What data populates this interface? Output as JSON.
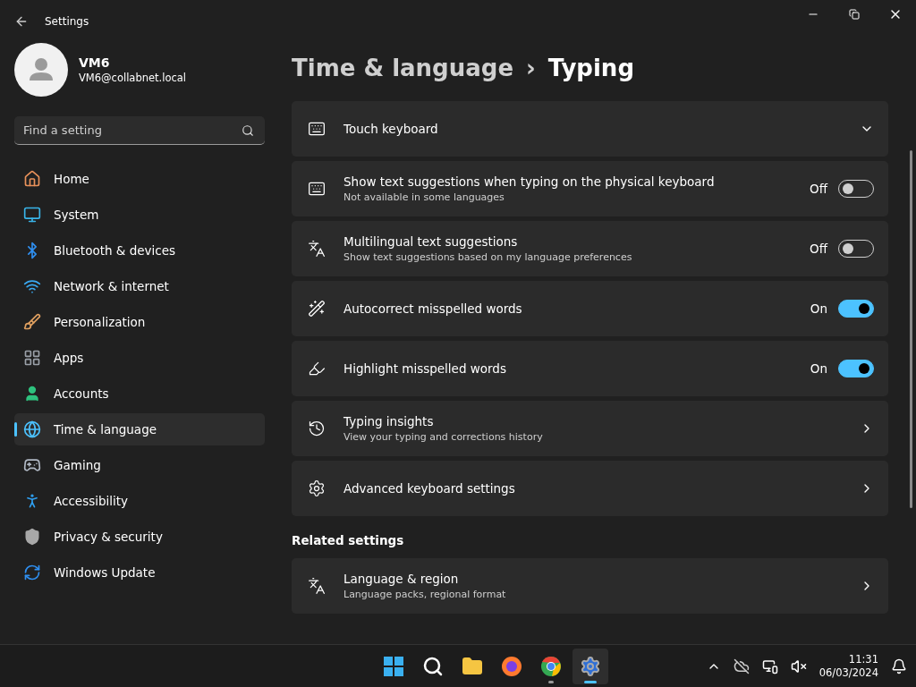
{
  "window": {
    "title": "Settings"
  },
  "user": {
    "name": "VM6",
    "email": "VM6@collabnet.local"
  },
  "search": {
    "placeholder": "Find a setting"
  },
  "sidebar": {
    "items": [
      {
        "label": "Home",
        "selected": false
      },
      {
        "label": "System",
        "selected": false
      },
      {
        "label": "Bluetooth & devices",
        "selected": false
      },
      {
        "label": "Network & internet",
        "selected": false
      },
      {
        "label": "Personalization",
        "selected": false
      },
      {
        "label": "Apps",
        "selected": false
      },
      {
        "label": "Accounts",
        "selected": false
      },
      {
        "label": "Time & language",
        "selected": true
      },
      {
        "label": "Gaming",
        "selected": false
      },
      {
        "label": "Accessibility",
        "selected": false
      },
      {
        "label": "Privacy & security",
        "selected": false
      },
      {
        "label": "Windows Update",
        "selected": false
      }
    ]
  },
  "breadcrumb": {
    "parent": "Time & language",
    "separator": "›",
    "current": "Typing"
  },
  "settings": [
    {
      "kind": "expander",
      "title": "Touch keyboard"
    },
    {
      "kind": "toggle",
      "title": "Show text suggestions when typing on the physical keyboard",
      "subtitle": "Not available in some languages",
      "state_label": "Off",
      "on": false
    },
    {
      "kind": "toggle",
      "title": "Multilingual text suggestions",
      "subtitle": "Show text suggestions based on my language preferences",
      "state_label": "Off",
      "on": false
    },
    {
      "kind": "toggle",
      "title": "Autocorrect misspelled words",
      "state_label": "On",
      "on": true
    },
    {
      "kind": "toggle",
      "title": "Highlight misspelled words",
      "state_label": "On",
      "on": true
    },
    {
      "kind": "link",
      "title": "Typing insights",
      "subtitle": "View your typing and corrections history"
    },
    {
      "kind": "link",
      "title": "Advanced keyboard settings"
    }
  ],
  "related_settings": {
    "heading": "Related settings",
    "items": [
      {
        "kind": "link",
        "title": "Language & region",
        "subtitle": "Language packs, regional format"
      }
    ]
  },
  "taskbar": {
    "time": "11:31",
    "date": "06/03/2024"
  }
}
